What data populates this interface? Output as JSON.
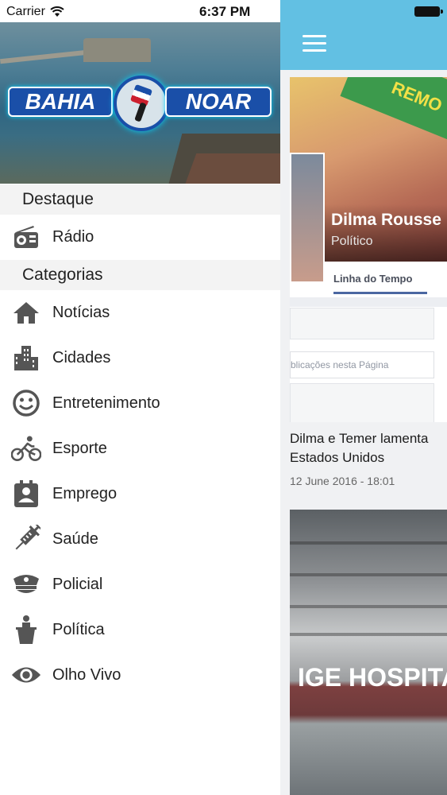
{
  "status_bar": {
    "carrier": "Carrier",
    "time": "6:37 PM"
  },
  "banner": {
    "logo_left": "BAHIA",
    "logo_right": "NOAR"
  },
  "sections": {
    "featured": "Destaque",
    "categories": "Categorias"
  },
  "featured_items": [
    {
      "label": "Rádio",
      "icon": "radio-icon"
    }
  ],
  "category_items": [
    {
      "label": "Notícias",
      "icon": "home-icon"
    },
    {
      "label": "Cidades",
      "icon": "city-icon"
    },
    {
      "label": "Entretenimento",
      "icon": "smiley-icon"
    },
    {
      "label": "Esporte",
      "icon": "bicycle-icon"
    },
    {
      "label": "Emprego",
      "icon": "id-badge-icon"
    },
    {
      "label": "Saúde",
      "icon": "syringe-icon"
    },
    {
      "label": "Policial",
      "icon": "police-cap-icon"
    },
    {
      "label": "Política",
      "icon": "podium-icon"
    },
    {
      "label": "Olho Vivo",
      "icon": "eye-icon"
    }
  ],
  "main": {
    "card1": {
      "cover_text": "REMO",
      "page_name": "Dilma Rousse",
      "page_category": "Político",
      "tab": "Linha do Tempo",
      "placeholder_text": "blicações nesta Página",
      "headline_line1": "Dilma e Temer lamenta",
      "headline_line2": "Estados Unidos",
      "date": "12 June 2016 - 18:01"
    },
    "card2": {
      "sign_text": "IGE HOSPITA"
    }
  },
  "colors": {
    "navbar": "#62c0e3",
    "icon_gray": "#555555",
    "section_bg": "#f3f3f3"
  }
}
